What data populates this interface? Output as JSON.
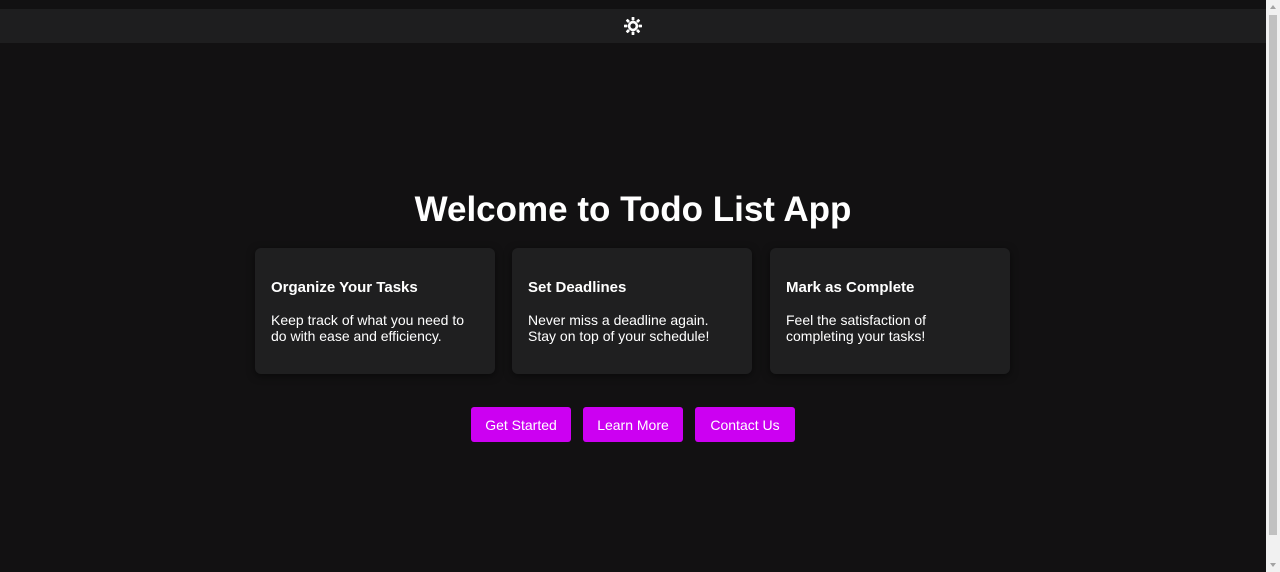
{
  "header": {
    "theme_toggle_icon": "sun-icon"
  },
  "hero": {
    "title": "Welcome to Todo List App"
  },
  "features": [
    {
      "title": "Organize Your Tasks",
      "description": "Keep track of what you need to do with ease and efficiency."
    },
    {
      "title": "Set Deadlines",
      "description": "Never miss a deadline again. Stay on top of your schedule!"
    },
    {
      "title": "Mark as Complete",
      "description": "Feel the satisfaction of completing your tasks!"
    }
  ],
  "actions": {
    "get_started": "Get Started",
    "learn_more": "Learn More",
    "contact_us": "Contact Us"
  },
  "colors": {
    "background": "#121112",
    "topbar": "#1e1e1f",
    "card": "#1f1f20",
    "accent": "#cc00f2",
    "text": "#ffffff"
  }
}
